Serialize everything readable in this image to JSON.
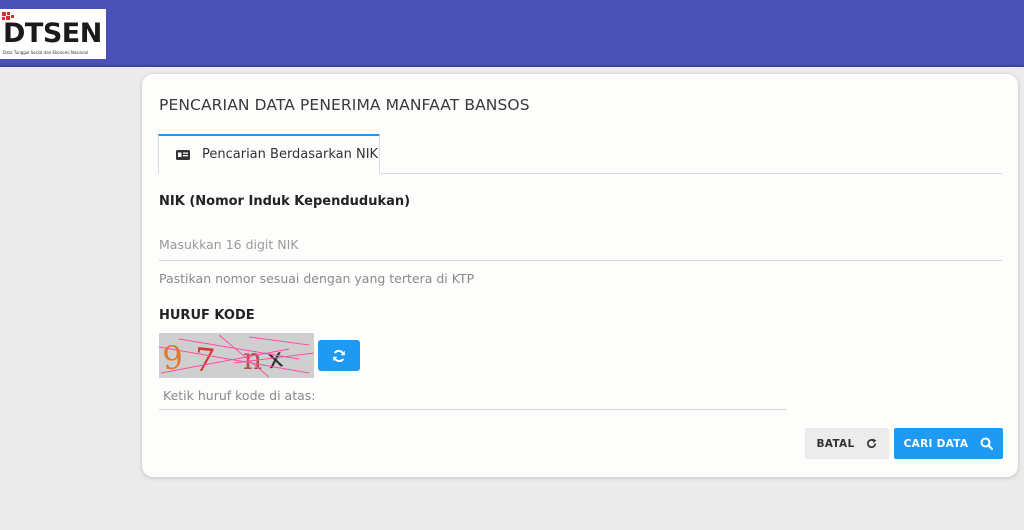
{
  "header": {
    "logo_text": "DTSEN",
    "logo_subtext": "Data Tunggal Sosial dan Ekonomi Nasional",
    "colors": {
      "bar": "#4b51b6",
      "logo_mark": "#d32f2f"
    }
  },
  "card": {
    "title": "PENCARIAN DATA PENERIMA MANFAAT BANSOS",
    "tabs": [
      {
        "label": "Pencarian Berdasarkan NIK",
        "icon": "id-card-icon",
        "active": true
      }
    ]
  },
  "form": {
    "nik_label": "NIK (Nomor Induk Kependudukan)",
    "nik_value": "",
    "nik_placeholder": "Masukkan 16 digit NIK",
    "nik_hint": "Pastikan nomor sesuai dengan yang tertera di KTP",
    "code_label": "HURUF KODE",
    "captcha_text": "97nx",
    "refresh_icon": "refresh-icon",
    "code_value": "",
    "code_placeholder": "Ketik huruf kode di atas:"
  },
  "actions": {
    "cancel_label": "BATAL",
    "cancel_icon": "reload-icon",
    "search_label": "CARI DATA",
    "search_icon": "search-icon",
    "accent": "#1e9af3"
  }
}
